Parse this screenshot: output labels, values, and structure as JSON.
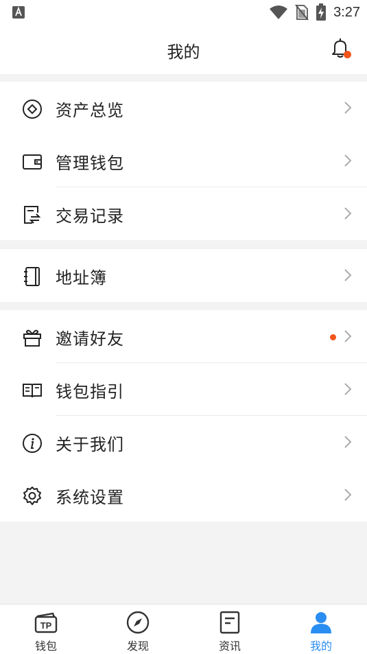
{
  "status_bar": {
    "time": "3:27",
    "icons": [
      "keyboard-a-icon",
      "wifi-icon",
      "no-sim-icon",
      "battery-charging-icon"
    ]
  },
  "header": {
    "title": "我的",
    "bell_icon": "bell-icon",
    "notification_dot_color": "#f2541b"
  },
  "groups": [
    {
      "items": [
        {
          "label": "资产总览",
          "icon": "asset-overview-icon"
        },
        {
          "label": "管理钱包",
          "icon": "wallet-icon"
        },
        {
          "label": "交易记录",
          "icon": "transaction-record-icon"
        }
      ]
    },
    {
      "items": [
        {
          "label": "地址簿",
          "icon": "address-book-icon"
        }
      ]
    },
    {
      "items": [
        {
          "label": "邀请好友",
          "icon": "gift-icon",
          "badge_dot": true
        },
        {
          "label": "钱包指引",
          "icon": "guide-book-icon"
        },
        {
          "label": "关于我们",
          "icon": "info-icon"
        },
        {
          "label": "系统设置",
          "icon": "settings-gear-icon"
        }
      ]
    }
  ],
  "tabbar": {
    "active_color": "#2a8df2",
    "tabs": [
      {
        "label": "钱包",
        "icon": "tp-wallet-icon",
        "active": false
      },
      {
        "label": "发现",
        "icon": "compass-icon",
        "active": false
      },
      {
        "label": "资讯",
        "icon": "news-icon",
        "active": false
      },
      {
        "label": "我的",
        "icon": "user-icon",
        "active": true
      }
    ]
  }
}
